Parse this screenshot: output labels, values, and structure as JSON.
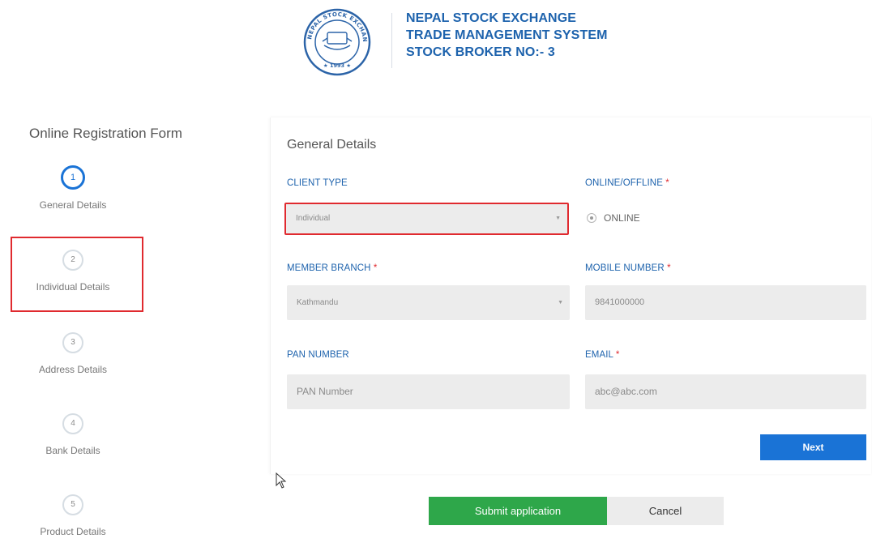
{
  "header": {
    "logo_text": "NEPAL STOCK EXCHANGE LTD. 1993",
    "line1": "NEPAL STOCK EXCHANGE",
    "line2": "TRADE MANAGEMENT SYSTEM",
    "line3": "STOCK BROKER NO:- 3",
    "color": "#1e63ad"
  },
  "sidebar": {
    "title": "Online Registration Form",
    "steps": [
      {
        "number": "1",
        "label": "General Details",
        "active": true
      },
      {
        "number": "2",
        "label": "Individual Details",
        "active": false
      },
      {
        "number": "3",
        "label": "Address Details",
        "active": false
      },
      {
        "number": "4",
        "label": "Bank Details",
        "active": false
      },
      {
        "number": "5",
        "label": "Product Details",
        "active": false
      }
    ]
  },
  "form": {
    "title": "General Details",
    "client_type": {
      "label": "CLIENT TYPE",
      "value": "Individual"
    },
    "online_offline": {
      "label": "ONLINE/OFFLINE",
      "required": "*",
      "option": "ONLINE"
    },
    "member_branch": {
      "label": "MEMBER BRANCH",
      "required": "*",
      "value": "Kathmandu"
    },
    "mobile_number": {
      "label": "MOBILE NUMBER",
      "required": "*",
      "value": "9841000000"
    },
    "pan_number": {
      "label": "PAN NUMBER",
      "placeholder": "PAN Number"
    },
    "email": {
      "label": "EMAIL",
      "required": "*",
      "value": "abc@abc.com"
    },
    "next_label": "Next"
  },
  "actions": {
    "submit_label": "Submit application",
    "cancel_label": "Cancel"
  },
  "colors": {
    "accent": "#1a73d6",
    "submit": "#2ea74a",
    "highlight": "#e02a2f"
  }
}
